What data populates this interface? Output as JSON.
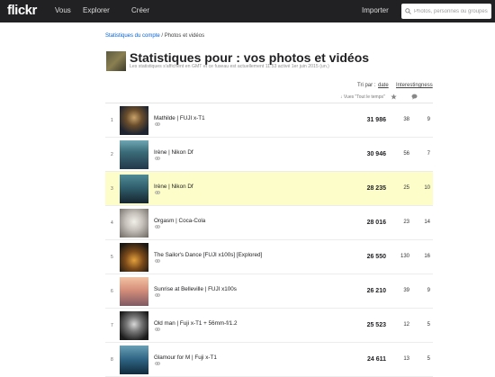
{
  "nav": {
    "logo": "flickr",
    "vous": "Vous",
    "explorer": "Explorer",
    "creer": "Créer",
    "importer": "Importer",
    "search_placeholder": "Photos, personnes ou groupes"
  },
  "breadcrumb": {
    "link": "Statistiques du compte",
    "separator": "/",
    "current": "Photos et vidéos"
  },
  "header": {
    "title": "Statistiques pour : vos photos et vidéos",
    "subtitle": "Les statistiques s'affichent en GMT et ce fuseau est actuellement 11:53 activé 1er juin 2015 (un.)"
  },
  "sort": {
    "label": "Tri par :",
    "date": "date",
    "interestingness": "Interestingness"
  },
  "columns": {
    "views": "↓ Vues \"Tout le temps\""
  },
  "rows": [
    {
      "rank": "1",
      "title": "Mathilde | FUJI x-T1",
      "views": "31 986",
      "favs": "38",
      "comments": "9"
    },
    {
      "rank": "2",
      "title": "Irène | Nikon Df",
      "views": "30 946",
      "favs": "56",
      "comments": "7"
    },
    {
      "rank": "3",
      "title": "Irène | Nikon Df",
      "views": "28 235",
      "favs": "25",
      "comments": "10"
    },
    {
      "rank": "4",
      "title": "Orgasm | Coca-Cola",
      "views": "28 016",
      "favs": "23",
      "comments": "14"
    },
    {
      "rank": "5",
      "title": "The Sailor's Dance [FUJI x100s] [Explored]",
      "views": "26 550",
      "favs": "130",
      "comments": "16"
    },
    {
      "rank": "6",
      "title": "Sunrise at Belleville | FUJI x100s",
      "views": "26 210",
      "favs": "39",
      "comments": "9"
    },
    {
      "rank": "7",
      "title": "Old man | Fuji x-T1 + 56mm-f/1.2",
      "views": "25 523",
      "favs": "12",
      "comments": "5"
    },
    {
      "rank": "8",
      "title": "Glamour for M | Fuji x-T1",
      "views": "24 611",
      "favs": "13",
      "comments": "5"
    }
  ],
  "highlight_color": "#fdfdc9",
  "icons": {
    "search": "search-icon",
    "star": "star-icon",
    "comment": "comment-icon",
    "link": "link-icon"
  }
}
